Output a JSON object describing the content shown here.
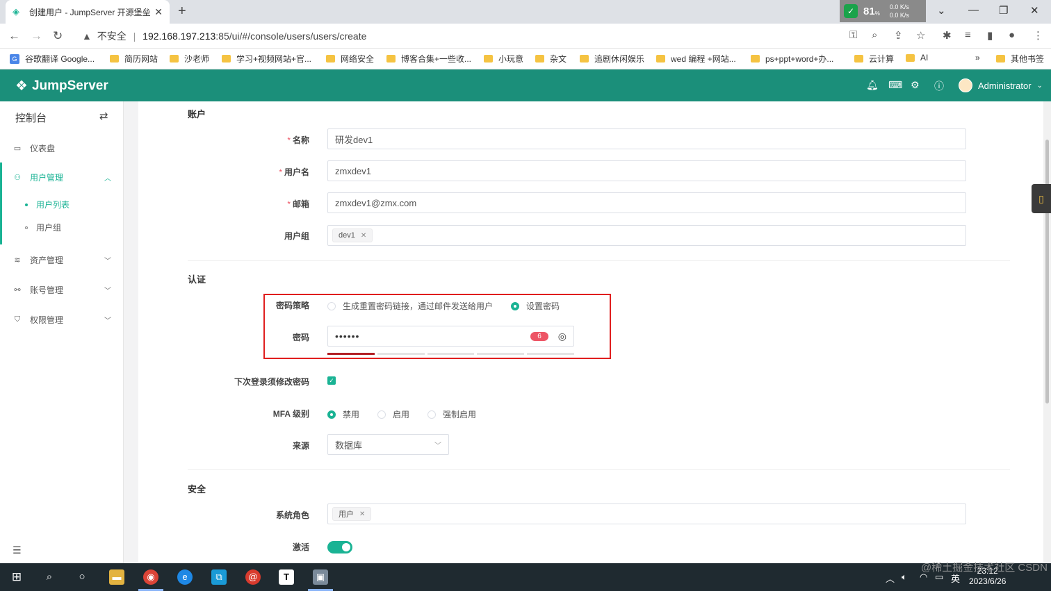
{
  "browser": {
    "tab_title": "创建用户 - JumpServer 开源堡垒",
    "tab_close": "✕",
    "new_tab": "+",
    "url_warning": "不安全",
    "url_sep": "|",
    "url_host": "192.168.197.213",
    "url_path": ":85/ui/#/console/users/users/create",
    "net_percent": "81",
    "net_percent_unit": "%",
    "net_up": "0.0 K/s",
    "net_down": "0.0 K/s"
  },
  "bookmarks": [
    "谷歌翻译 Google...",
    "简历网站",
    "沙老师",
    "学习+视频网站+官...",
    "网络安全",
    "博客合集+一些收...",
    "小玩意",
    "杂文",
    "追剧休闲娱乐",
    "wed 编程 +网站...",
    "ps+ppt+word+办...",
    "云计算",
    "AI",
    "»",
    "其他书签"
  ],
  "app": {
    "brand": "JumpServer",
    "user_name": "Administrator"
  },
  "sidebar": {
    "title": "控制台",
    "items": [
      {
        "label": "仪表盘",
        "icon": "dashboard-icon"
      },
      {
        "label": "用户管理",
        "icon": "users-icon"
      },
      {
        "label": "资产管理",
        "icon": "assets-icon"
      },
      {
        "label": "账号管理",
        "icon": "accounts-icon"
      },
      {
        "label": "权限管理",
        "icon": "permissions-icon"
      }
    ],
    "sub_items": [
      {
        "label": "用户列表",
        "active": true
      },
      {
        "label": "用户组",
        "active": false
      }
    ]
  },
  "form": {
    "section_account": "账户",
    "name_label": "名称",
    "name_value": "研发dev1",
    "username_label": "用户名",
    "username_value": "zmxdev1",
    "email_label": "邮箱",
    "email_value": "zmxdev1@zmx.com",
    "group_label": "用户组",
    "group_tag": "dev1",
    "section_auth": "认证",
    "pwd_strategy_label": "密码策略",
    "pwd_strategy_options": [
      "生成重置密码链接，通过邮件发送给用户",
      "设置密码"
    ],
    "pwd_label": "密码",
    "pwd_mask": "••••••",
    "pwd_length": "6",
    "pwd_strength_level": 1,
    "pwd_strength_segments": 5,
    "must_change_label": "下次登录须修改密码",
    "mfa_label": "MFA 级别",
    "mfa_options": [
      "禁用",
      "启用",
      "强制启用"
    ],
    "source_label": "来源",
    "source_value": "数据库",
    "section_security": "安全",
    "role_label": "系统角色",
    "role_tag": "用户",
    "active_label": "激活"
  },
  "taskbar": {
    "time": "23:12",
    "date": "2023/6/26",
    "ime": "英",
    "watermark": "@稀土掘金技术社区 CSDN @川水往事"
  },
  "colors": {
    "brand": "#1b8f7a",
    "accent": "#1ab394",
    "danger": "#ed5565",
    "highlight_box": "#e01e1e"
  }
}
